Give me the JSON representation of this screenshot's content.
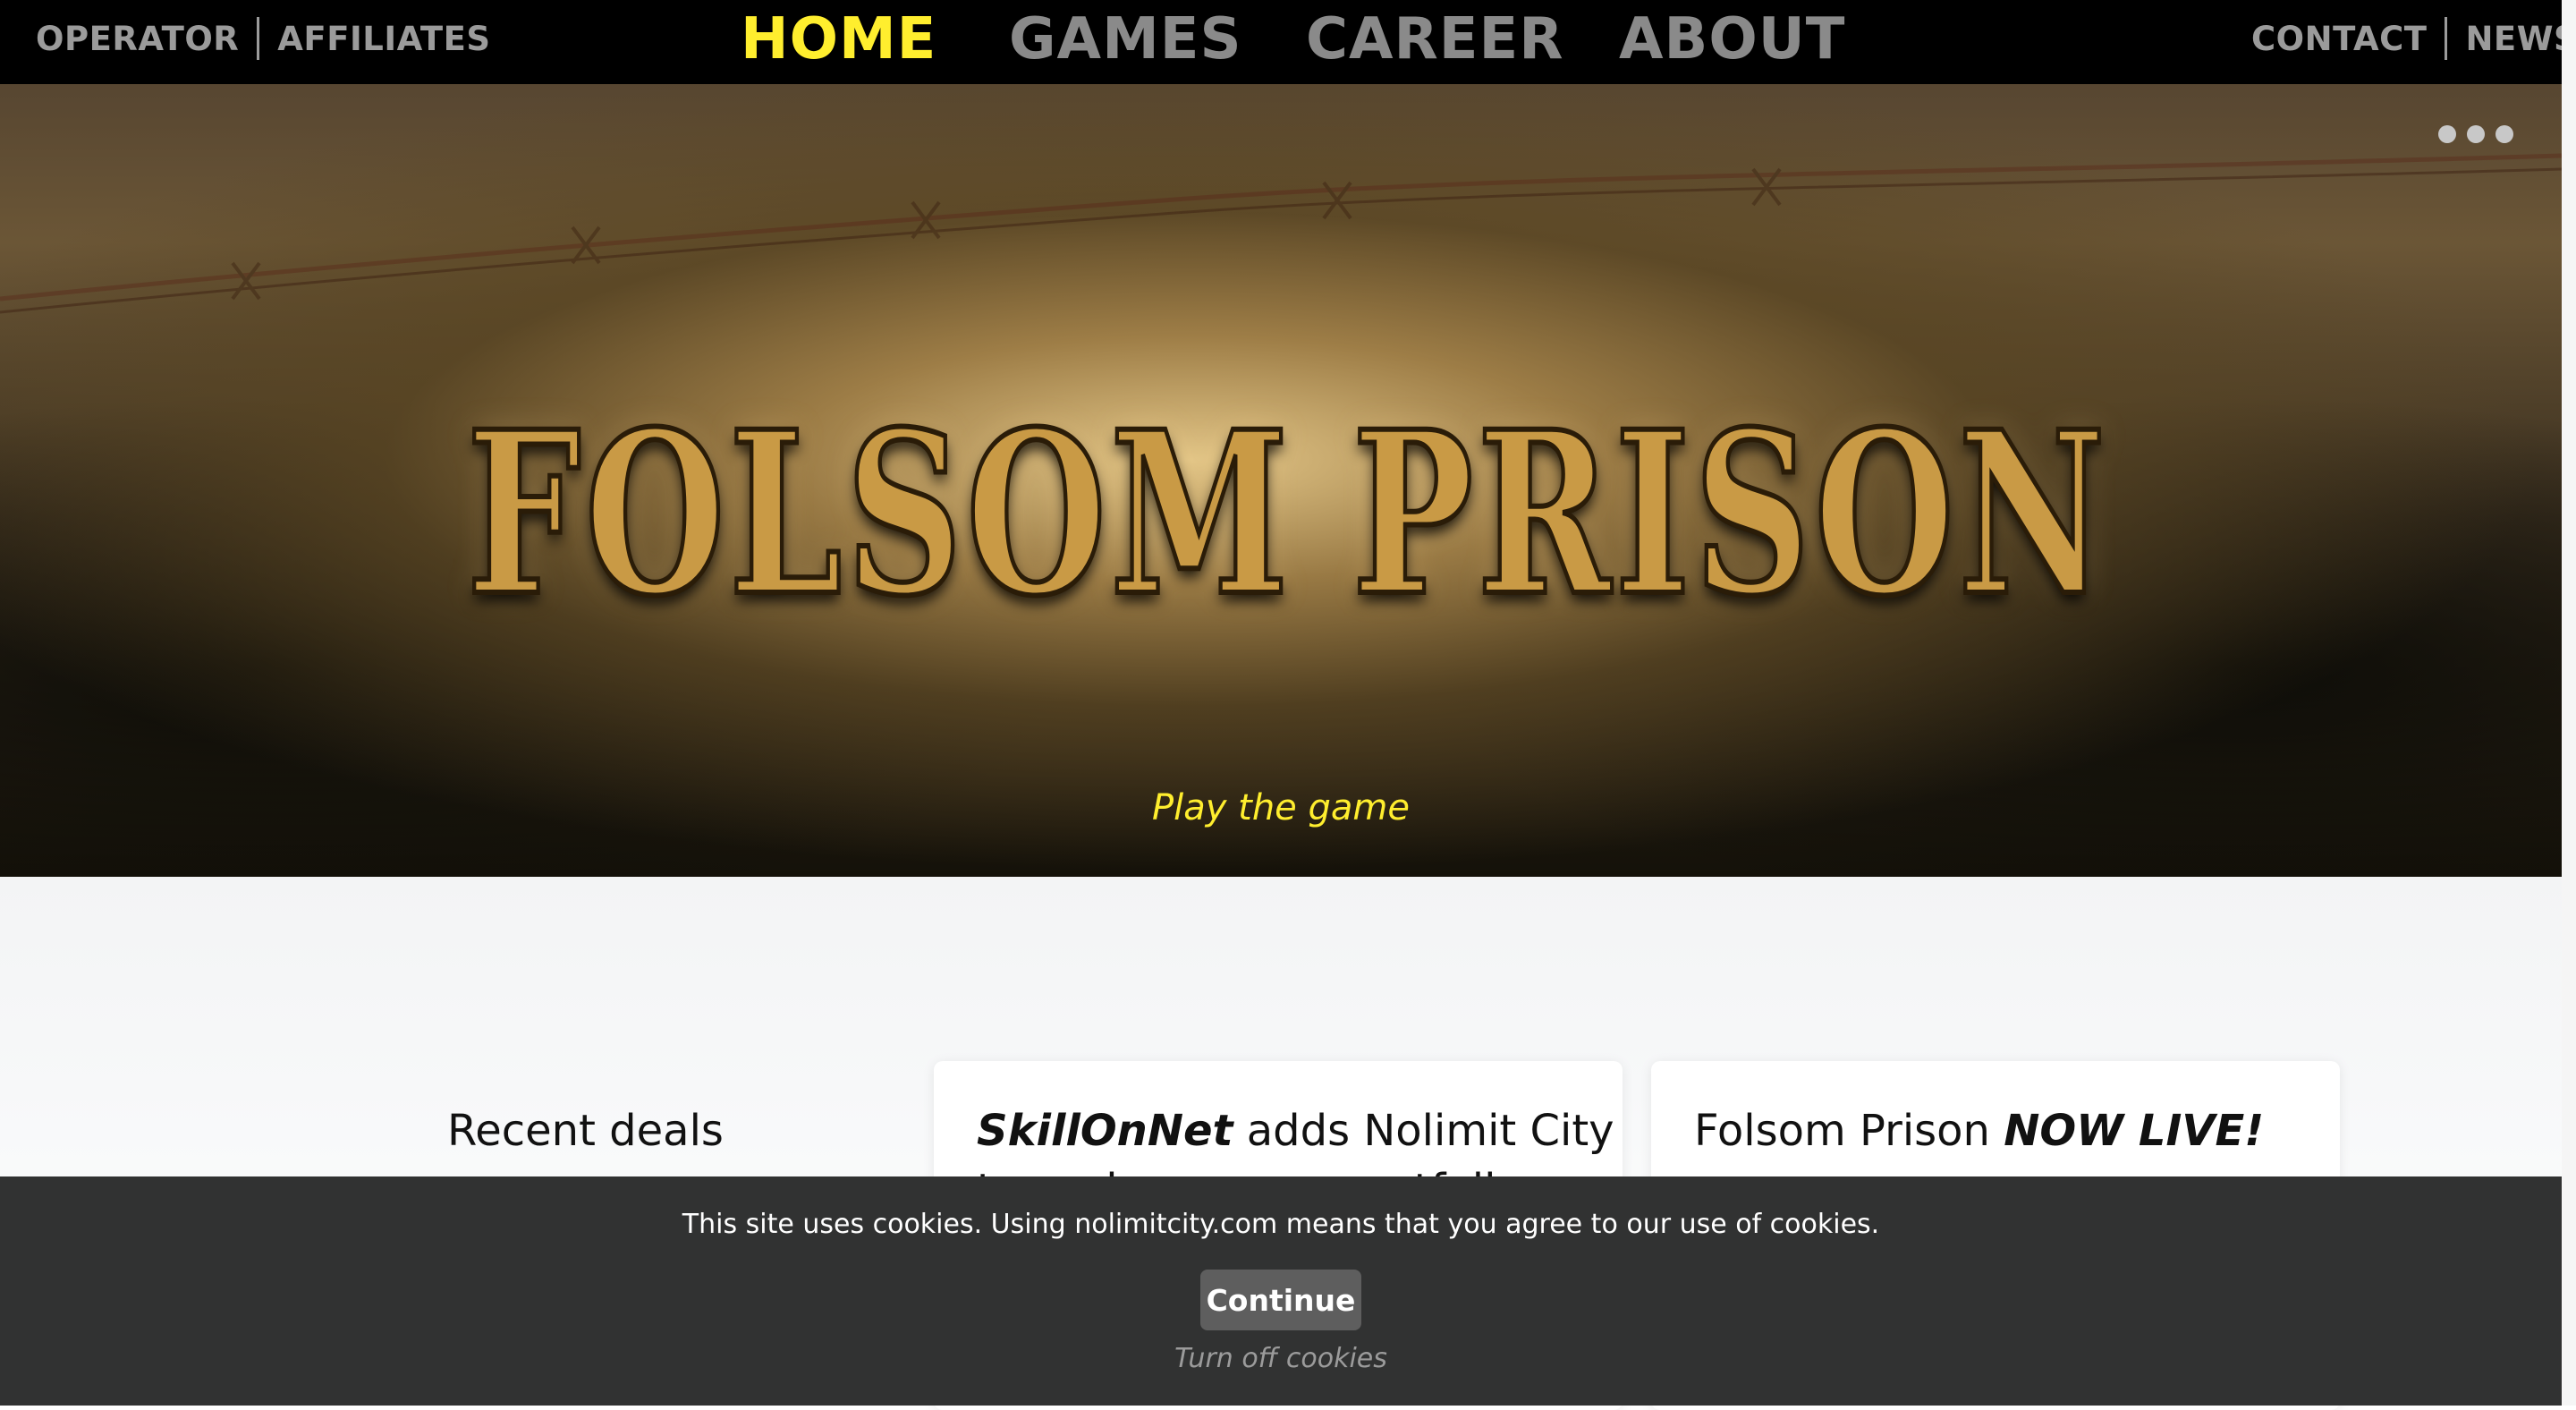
{
  "nav": {
    "left_links": [
      "OPERATOR",
      "AFFILIATES"
    ],
    "main_links": [
      "HOME",
      "GAMES",
      "CAREER",
      "ABOUT"
    ],
    "active": "HOME",
    "right_links": [
      "CONTACT",
      "NEWS"
    ],
    "active_color": "#ffee2e"
  },
  "hero": {
    "game_logo_text": "FOLSOM PRISON",
    "cta": "Play the game",
    "slide_count": 3,
    "active_slide": 1
  },
  "content": {
    "deals_title": "Recent deals",
    "card1": {
      "title_bold": "SkillOnNet",
      "title_rest": " adds Nolimit City",
      "title_line2_partial": "to casino games portfolio"
    },
    "card2": {
      "title_rest": "Folsom Prison ",
      "title_bold": "NOW LIVE!"
    }
  },
  "cookie": {
    "message": "This site uses cookies. Using nolimitcity.com means that you agree to our use of cookies.",
    "continue_label": "Continue",
    "turn_off_label": "Turn off cookies"
  }
}
